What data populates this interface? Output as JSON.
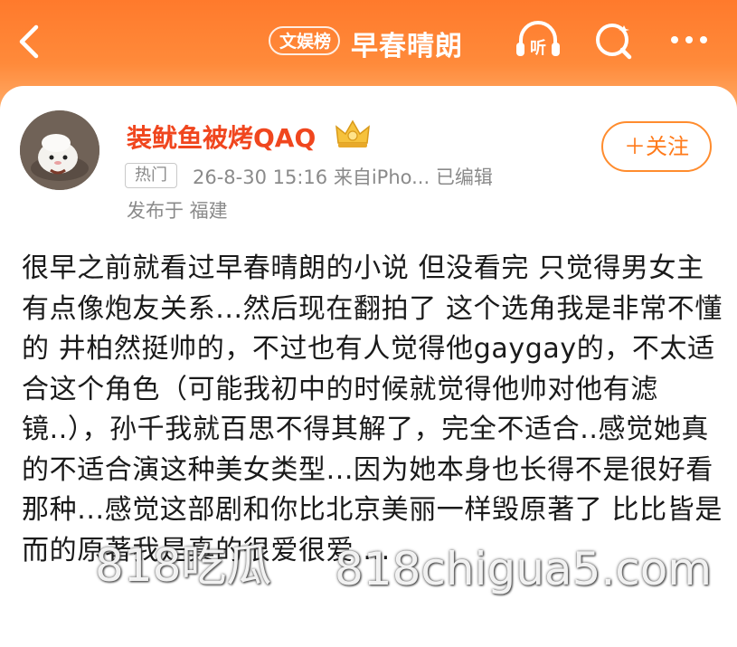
{
  "header": {
    "tag": "文娱榜",
    "title": "早春晴朗",
    "listen_label": "听"
  },
  "post": {
    "username": "装鱿鱼被烤QAQ",
    "hot_badge": "热门",
    "meta": "26-8-30 15:16  来自iPho...  已编辑",
    "location": "发布于 福建",
    "follow_label": "＋关注",
    "content": "很早之前就看过早春晴朗的小说 但没看完 只觉得男女主有点像炮友关系...然后现在翻拍了 这个选角我是非常不懂的 井柏然挺帅的，不过也有人觉得他gaygay的，不太适合这个角色（可能我初中的时候就觉得他帅对他有滤镜..），孙千我就百思不得其解了，完全不适合..感觉她真的不适合演这种美女类型...因为她本身也长得不是很好看那种...感觉这部剧和你比北京美丽一样毁原著了 比比皆是而的原著我是真的很爱很爱...."
  },
  "watermarks": [
    "818吃瓜",
    "818chigua5.com"
  ],
  "colors": {
    "header_orange": "#ff7a2c",
    "username": "#f0461e",
    "follow": "#ff7a1a"
  }
}
